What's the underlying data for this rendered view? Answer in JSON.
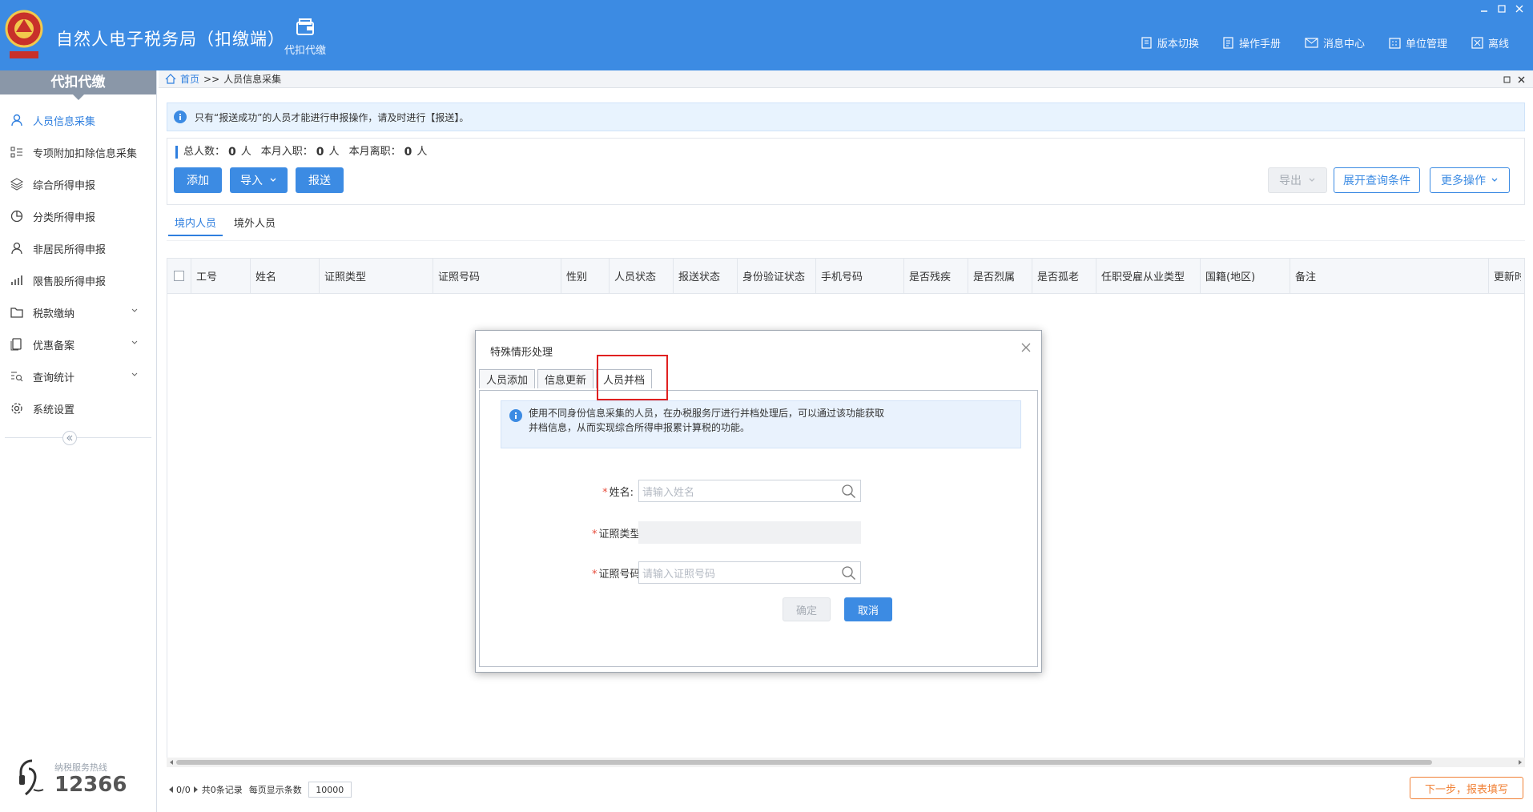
{
  "header": {
    "app_title": "自然人电子税务局（扣缴端）",
    "nav_label": "代扣代缴",
    "actions": [
      {
        "label": "版本切换",
        "icon": "document-icon"
      },
      {
        "label": "操作手册",
        "icon": "manual-icon"
      },
      {
        "label": "消息中心",
        "icon": "mail-icon"
      },
      {
        "label": "单位管理",
        "icon": "building-icon"
      },
      {
        "label": "离线",
        "icon": "offline-icon"
      }
    ]
  },
  "sidebar": {
    "title": "代扣代缴",
    "items": [
      {
        "label": "人员信息采集",
        "icon": "person-icon"
      },
      {
        "label": "专项附加扣除信息采集",
        "icon": "list-icon"
      },
      {
        "label": "综合所得申报",
        "icon": "layers-icon"
      },
      {
        "label": "分类所得申报",
        "icon": "pie-icon"
      },
      {
        "label": "非居民所得申报",
        "icon": "person-icon"
      },
      {
        "label": "限售股所得申报",
        "icon": "bar-chart-icon"
      },
      {
        "label": "税款缴纳",
        "icon": "folder-icon"
      },
      {
        "label": "优惠备案",
        "icon": "copy-icon"
      },
      {
        "label": "查询统计",
        "icon": "search-list-icon"
      },
      {
        "label": "系统设置",
        "icon": "gear-icon"
      }
    ],
    "hotline_label": "纳税服务热线",
    "hotline_number": "12366"
  },
  "breadcrumb": {
    "home": "首页",
    "sep": ">>",
    "current": "人员信息采集"
  },
  "notice": "只有“报送成功”的人员才能进行申报操作，请及时进行【报送】。",
  "stats": {
    "total_label": "总人数：",
    "total": "0",
    "unit": "人",
    "month_in_label": "本月入职：",
    "month_in": "0",
    "month_out_label": "本月离职：",
    "month_out": "0"
  },
  "toolbar": {
    "add": "添加",
    "import": "导入",
    "submit": "报送",
    "export": "导出",
    "expand_query": "展开查询条件",
    "more_ops": "更多操作"
  },
  "tabs": [
    "境内人员",
    "境外人员"
  ],
  "table": {
    "columns": [
      "工号",
      "姓名",
      "证照类型",
      "证照号码",
      "性别",
      "人员状态",
      "报送状态",
      "身份验证状态",
      "手机号码",
      "是否残疾",
      "是否烈属",
      "是否孤老",
      "任职受雇从业类型",
      "国籍(地区)",
      "备注",
      "更新时"
    ]
  },
  "pager": {
    "pages": "0/0",
    "records": "共0条记录",
    "per_page_label": "每页显示条数",
    "per_page": "10000"
  },
  "next_button": "下一步，报表填写",
  "modal": {
    "title": "特殊情形处理",
    "tabs": [
      "人员添加",
      "信息更新",
      "人员并档"
    ],
    "info_line1": "使用不同身份信息采集的人员，在办税服务厅进行并档处理后，可以通过该功能获取",
    "info_line2": "并档信息，从而实现综合所得申报累计算税的功能。",
    "name_label": "姓名:",
    "name_placeholder": "请输入姓名",
    "idtype_label": "证照类型:",
    "idno_label": "证照号码:",
    "idno_placeholder": "请输入证照号码",
    "required_mark": "*",
    "confirm": "确定",
    "cancel": "取消"
  }
}
